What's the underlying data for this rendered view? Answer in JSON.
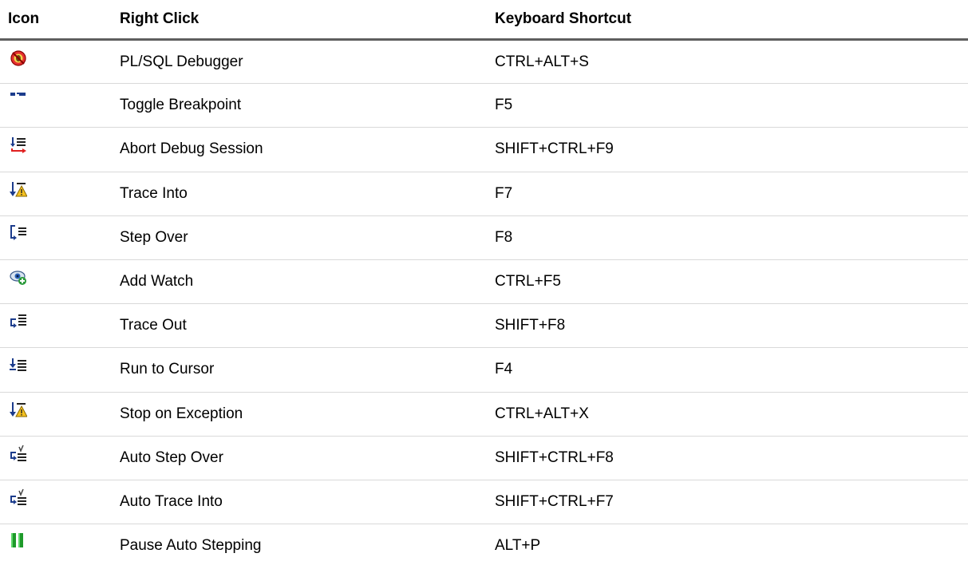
{
  "table": {
    "headers": {
      "icon": "Icon",
      "right_click": "Right Click",
      "keyboard_shortcut": "Keyboard Shortcut"
    },
    "rows": [
      {
        "icon": "debugger-bug-icon",
        "right_click": "PL/SQL Debugger",
        "shortcut": "CTRL+ALT+S"
      },
      {
        "icon": "toggle-breakpoint-icon",
        "right_click": "Toggle Breakpoint",
        "shortcut": "F5"
      },
      {
        "icon": "abort-debug-icon",
        "right_click": "Abort Debug Session",
        "shortcut": "SHIFT+CTRL+F9"
      },
      {
        "icon": "trace-into-icon",
        "right_click": "Trace Into",
        "shortcut": "F7"
      },
      {
        "icon": "step-over-icon",
        "right_click": "Step Over",
        "shortcut": "F8"
      },
      {
        "icon": "add-watch-icon",
        "right_click": "Add Watch",
        "shortcut": "CTRL+F5"
      },
      {
        "icon": "trace-out-icon",
        "right_click": "Trace Out",
        "shortcut": "SHIFT+F8"
      },
      {
        "icon": "run-to-cursor-icon",
        "right_click": "Run to Cursor",
        "shortcut": "F4"
      },
      {
        "icon": "stop-on-exception-icon",
        "right_click": "Stop on Exception",
        "shortcut": "CTRL+ALT+X"
      },
      {
        "icon": "auto-step-over-icon",
        "right_click": "Auto Step Over",
        "shortcut": "SHIFT+CTRL+F8"
      },
      {
        "icon": "auto-trace-into-icon",
        "right_click": "Auto Trace Into",
        "shortcut": "SHIFT+CTRL+F7"
      },
      {
        "icon": "pause-icon",
        "right_click": "Pause Auto Stepping",
        "shortcut": "ALT+P"
      }
    ]
  }
}
